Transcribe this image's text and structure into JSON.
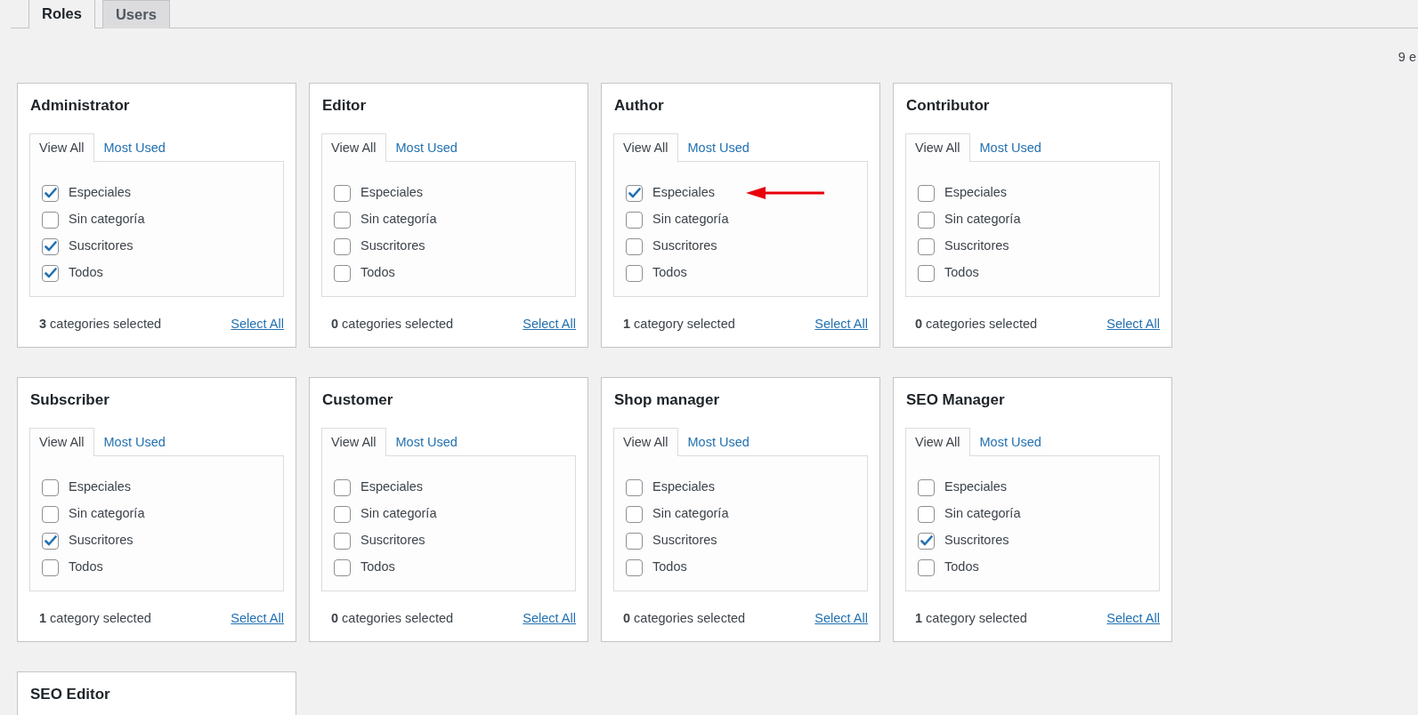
{
  "tabs": [
    {
      "label": "Roles",
      "selected": true
    },
    {
      "label": "Users",
      "selected": false
    }
  ],
  "top_right_text": "9 e",
  "roles": [
    {
      "title": "Administrator",
      "tabs": [
        {
          "label": "View All",
          "selected": true
        },
        {
          "label": "Most Used",
          "selected": false
        }
      ],
      "categories": [
        {
          "label": "Especiales",
          "checked": true
        },
        {
          "label": "Sin categoría",
          "checked": false
        },
        {
          "label": "Suscritores",
          "checked": true
        },
        {
          "label": "Todos",
          "checked": true
        }
      ],
      "count": "**3** categories selected",
      "select_all": "Select All"
    },
    {
      "title": "Editor",
      "tabs": [
        {
          "label": "View All",
          "selected": true
        },
        {
          "label": "Most Used",
          "selected": false
        }
      ],
      "categories": [
        {
          "label": "Especiales",
          "checked": false
        },
        {
          "label": "Sin categoría",
          "checked": false
        },
        {
          "label": "Suscritores",
          "checked": false
        },
        {
          "label": "Todos",
          "checked": false
        }
      ],
      "count": "**0** categories selected",
      "select_all": "Select All"
    },
    {
      "title": "Author",
      "tabs": [
        {
          "label": "View All",
          "selected": true
        },
        {
          "label": "Most Used",
          "selected": false
        }
      ],
      "categories": [
        {
          "label": "Especiales",
          "checked": true,
          "arrow": true
        },
        {
          "label": "Sin categoría",
          "checked": false
        },
        {
          "label": "Suscritores",
          "checked": false
        },
        {
          "label": "Todos",
          "checked": false
        }
      ],
      "count": "**1** category selected",
      "select_all": "Select All"
    },
    {
      "title": "Contributor",
      "tabs": [
        {
          "label": "View All",
          "selected": true
        },
        {
          "label": "Most Used",
          "selected": false
        }
      ],
      "categories": [
        {
          "label": "Especiales",
          "checked": false
        },
        {
          "label": "Sin categoría",
          "checked": false
        },
        {
          "label": "Suscritores",
          "checked": false
        },
        {
          "label": "Todos",
          "checked": false
        }
      ],
      "count": "**0** categories selected",
      "select_all": "Select All"
    },
    {
      "title": "Subscriber",
      "tabs": [
        {
          "label": "View All",
          "selected": true
        },
        {
          "label": "Most Used",
          "selected": false
        }
      ],
      "categories": [
        {
          "label": "Especiales",
          "checked": false
        },
        {
          "label": "Sin categoría",
          "checked": false
        },
        {
          "label": "Suscritores",
          "checked": true
        },
        {
          "label": "Todos",
          "checked": false
        }
      ],
      "count": "**1** category selected",
      "select_all": "Select All"
    },
    {
      "title": "Customer",
      "tabs": [
        {
          "label": "View All",
          "selected": true
        },
        {
          "label": "Most Used",
          "selected": false
        }
      ],
      "categories": [
        {
          "label": "Especiales",
          "checked": false
        },
        {
          "label": "Sin categoría",
          "checked": false
        },
        {
          "label": "Suscritores",
          "checked": false
        },
        {
          "label": "Todos",
          "checked": false
        }
      ],
      "count": "**0** categories selected",
      "select_all": "Select All"
    },
    {
      "title": "Shop manager",
      "tabs": [
        {
          "label": "View All",
          "selected": true
        },
        {
          "label": "Most Used",
          "selected": false
        }
      ],
      "categories": [
        {
          "label": "Especiales",
          "checked": false
        },
        {
          "label": "Sin categoría",
          "checked": false
        },
        {
          "label": "Suscritores",
          "checked": false
        },
        {
          "label": "Todos",
          "checked": false
        }
      ],
      "count": "**0** categories selected",
      "select_all": "Select All"
    },
    {
      "title": "SEO Manager",
      "tabs": [
        {
          "label": "View All",
          "selected": true
        },
        {
          "label": "Most Used",
          "selected": false
        }
      ],
      "categories": [
        {
          "label": "Especiales",
          "checked": false
        },
        {
          "label": "Sin categoría",
          "checked": false
        },
        {
          "label": "Suscritores",
          "checked": true
        },
        {
          "label": "Todos",
          "checked": false
        }
      ],
      "count": "**1** category selected",
      "select_all": "Select All"
    },
    {
      "title": "SEO Editor"
    }
  ]
}
